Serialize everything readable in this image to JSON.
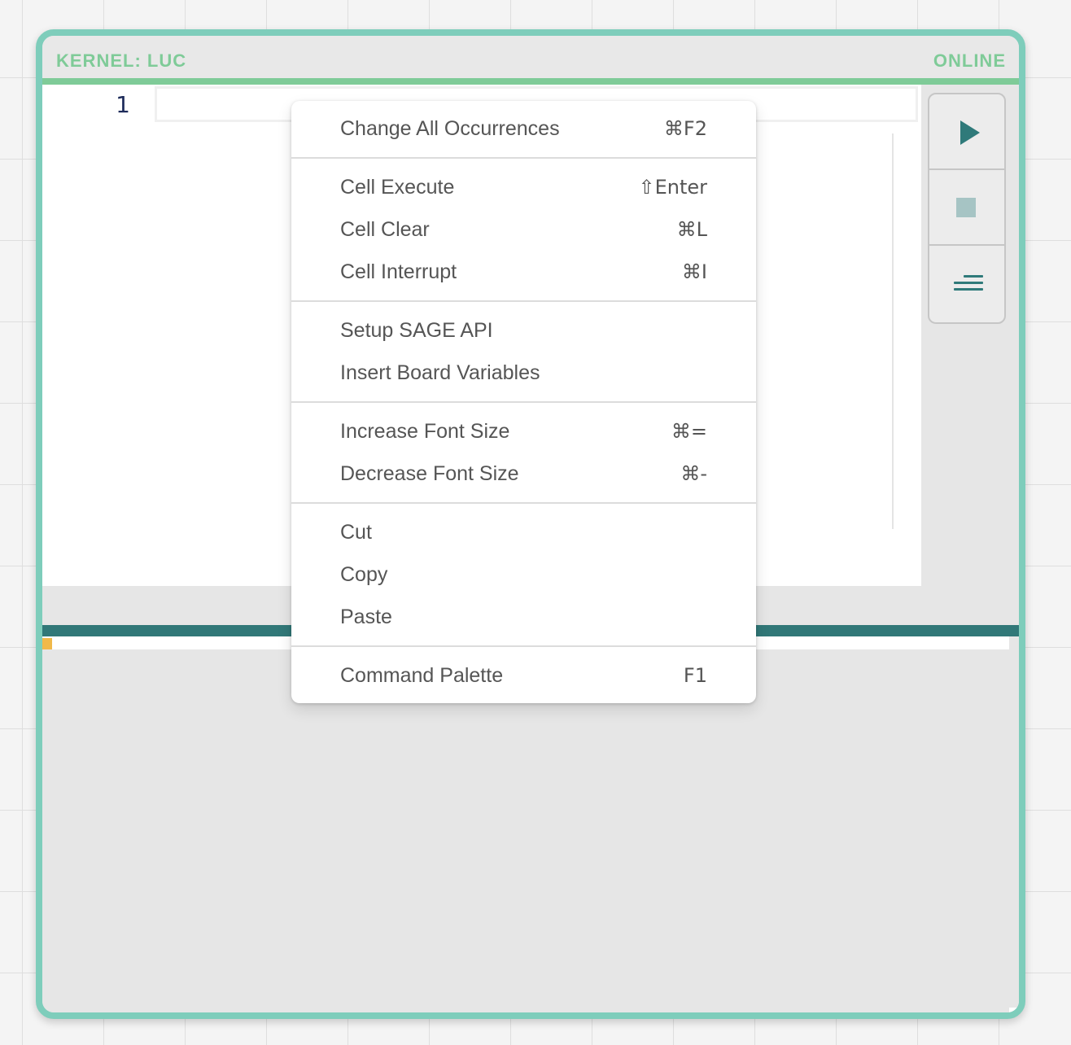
{
  "window": {
    "kernel_label": "KERNEL: LUC",
    "status": "ONLINE"
  },
  "editor": {
    "line_numbers": [
      "1"
    ],
    "code": ""
  },
  "toolbar": {
    "buttons": [
      {
        "name": "run",
        "icon": "play-icon"
      },
      {
        "name": "stop",
        "icon": "stop-icon"
      },
      {
        "name": "format",
        "icon": "lines-icon"
      }
    ]
  },
  "context_menu": {
    "groups": [
      [
        {
          "label": "Change All Occurrences",
          "shortcut": "⌘F2"
        }
      ],
      [
        {
          "label": "Cell Execute",
          "shortcut": "⇧Enter"
        },
        {
          "label": "Cell Clear",
          "shortcut": "⌘L"
        },
        {
          "label": "Cell Interrupt",
          "shortcut": "⌘I"
        }
      ],
      [
        {
          "label": "Setup SAGE API",
          "shortcut": ""
        },
        {
          "label": "Insert Board Variables",
          "shortcut": ""
        }
      ],
      [
        {
          "label": "Increase Font Size",
          "shortcut": "⌘="
        },
        {
          "label": "Decrease Font Size",
          "shortcut": "⌘-"
        }
      ],
      [
        {
          "label": "Cut",
          "shortcut": ""
        },
        {
          "label": "Copy",
          "shortcut": ""
        },
        {
          "label": "Paste",
          "shortcut": ""
        }
      ],
      [
        {
          "label": "Command Palette",
          "shortcut": "F1"
        }
      ]
    ]
  },
  "colors": {
    "border": "#7ecdbb",
    "title_accent": "#7fcb98",
    "output_bar": "#317878",
    "icon": "#2f7a7a",
    "marker": "#f0b94a"
  }
}
